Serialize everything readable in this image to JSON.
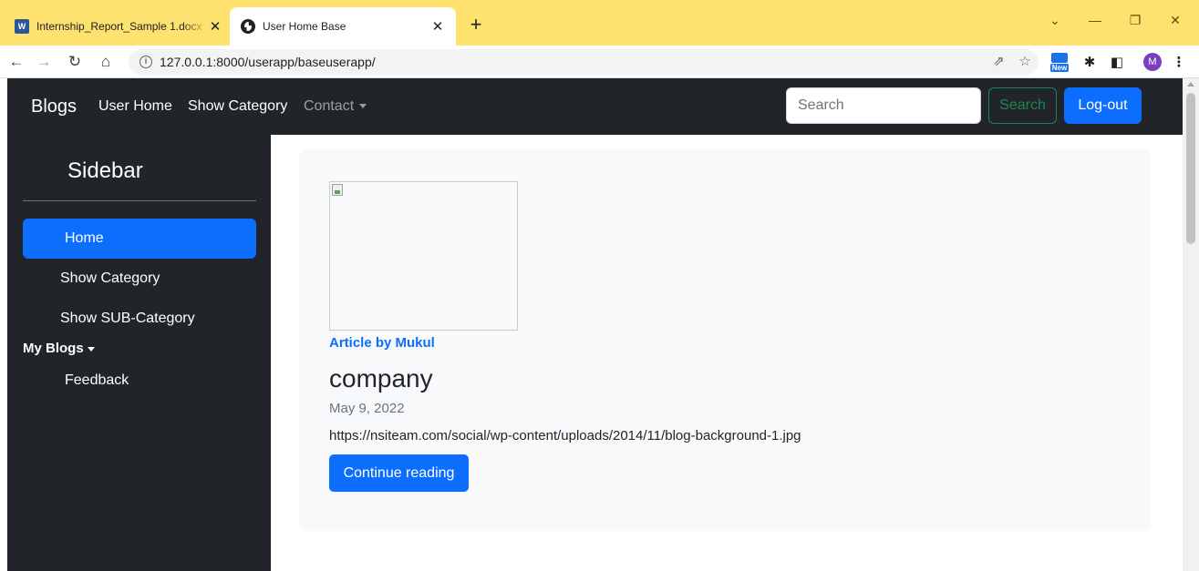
{
  "browser": {
    "tabs": [
      {
        "title": "Internship_Report_Sample 1.docx",
        "icon": "word-icon",
        "active": false
      },
      {
        "title": "User Home Base",
        "icon": "globe-icon",
        "active": true
      }
    ],
    "new_tab": "+",
    "controls": {
      "minimize": "—",
      "restore": "❐",
      "close": "✕",
      "dropdown": "⌄"
    },
    "url": "127.0.0.1:8000/userapp/baseuserapp/",
    "extension_new_label": "New",
    "profile_initial": "M",
    "tab_strip_color": "#fde26f"
  },
  "navbar": {
    "brand": "Blogs",
    "links": [
      "User Home",
      "Show Category"
    ],
    "dropdown": "Contact",
    "search_placeholder": "Search",
    "search_button": "Search",
    "logout_button": "Log-out"
  },
  "sidebar": {
    "title": "Sidebar",
    "items": [
      {
        "label": "Home",
        "active": true
      },
      {
        "label": "Show Category",
        "active": false
      },
      {
        "label": "Show SUB-Category",
        "active": false
      }
    ],
    "dropdown": "My Blogs",
    "feedback": "Feedback"
  },
  "post": {
    "author": "Article by Mukul",
    "title": "company",
    "date": "May 9, 2022",
    "text": "https://nsiteam.com/social/wp-content/uploads/2014/11/blog-background-1.jpg",
    "button": "Continue reading"
  },
  "colors": {
    "primary": "#0d6efd",
    "dark": "#212529",
    "success": "#198754",
    "card": "#f8f9fa"
  }
}
